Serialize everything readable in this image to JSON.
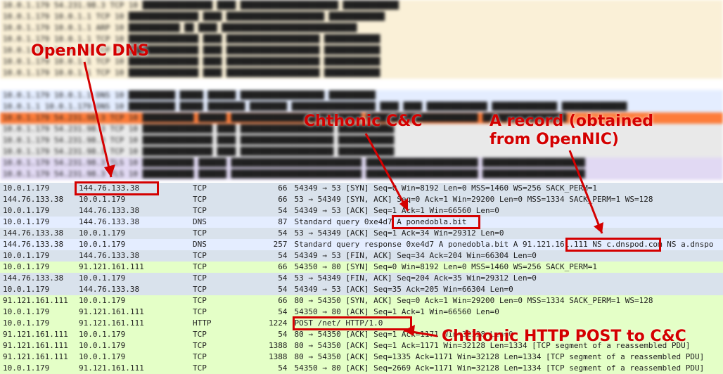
{
  "annotations": {
    "opennic": "OpenNIC DNS",
    "cc": "Chthonic C&C",
    "arecord1": "A record (obtained",
    "arecord2": "from OpenNIC)",
    "httppost": "Chthonic HTTP POST to C&C"
  },
  "packets": [
    {
      "bg": "bg-lightsteel",
      "src": "10.0.1.179",
      "dst": "144.76.133.38",
      "proto": "TCP",
      "len": "66",
      "info": "54349 → 53 [SYN] Seq=0 Win=8192 Len=0 MSS=1460 WS=256 SACK_PERM=1"
    },
    {
      "bg": "bg-lightsteel",
      "src": "144.76.133.38",
      "dst": "10.0.1.179",
      "proto": "TCP",
      "len": "66",
      "info": "53 → 54349 [SYN, ACK] Seq=0 Ack=1 Win=29200 Len=0 MSS=1334 SACK_PERM=1 WS=128"
    },
    {
      "bg": "bg-lightsteel",
      "src": "10.0.1.179",
      "dst": "144.76.133.38",
      "proto": "TCP",
      "len": "54",
      "info": "54349 → 53 [ACK] Seq=1 Ack=1 Win=66560 Len=0"
    },
    {
      "bg": "bg-skyblue",
      "src": "10.0.1.179",
      "dst": "144.76.133.38",
      "proto": "DNS",
      "len": "87",
      "info": "Standard query 0xe4d7 A ponedobla.bit"
    },
    {
      "bg": "bg-lightsteel",
      "src": "144.76.133.38",
      "dst": "10.0.1.179",
      "proto": "TCP",
      "len": "54",
      "info": "53 → 54349 [ACK] Seq=1 Ack=34 Win=29312 Len=0"
    },
    {
      "bg": "bg-skyblue",
      "src": "144.76.133.38",
      "dst": "10.0.1.179",
      "proto": "DNS",
      "len": "257",
      "info": "Standard query response 0xe4d7 A ponedobla.bit A 91.121.161.111 NS c.dnspod.com NS a.dnspo"
    },
    {
      "bg": "bg-lightsteel",
      "src": "10.0.1.179",
      "dst": "144.76.133.38",
      "proto": "TCP",
      "len": "54",
      "info": "54349 → 53 [FIN, ACK] Seq=34 Ack=204 Win=66304 Len=0"
    },
    {
      "bg": "bg-palegreen",
      "src": "10.0.1.179",
      "dst": "91.121.161.111",
      "proto": "TCP",
      "len": "66",
      "info": "54350 → 80 [SYN] Seq=0 Win=8192 Len=0 MSS=1460 WS=256 SACK_PERM=1"
    },
    {
      "bg": "bg-lightsteel",
      "src": "144.76.133.38",
      "dst": "10.0.1.179",
      "proto": "TCP",
      "len": "54",
      "info": "53 → 54349 [FIN, ACK] Seq=204 Ack=35 Win=29312 Len=0"
    },
    {
      "bg": "bg-lightsteel",
      "src": "10.0.1.179",
      "dst": "144.76.133.38",
      "proto": "TCP",
      "len": "54",
      "info": "54349 → 53 [ACK] Seq=35 Ack=205 Win=66304 Len=0"
    },
    {
      "bg": "bg-palegreen",
      "src": "91.121.161.111",
      "dst": "10.0.1.179",
      "proto": "TCP",
      "len": "66",
      "info": "80 → 54350 [SYN, ACK] Seq=0 Ack=1 Win=29200 Len=0 MSS=1334 SACK_PERM=1 WS=128"
    },
    {
      "bg": "bg-palegreen",
      "src": "10.0.1.179",
      "dst": "91.121.161.111",
      "proto": "TCP",
      "len": "54",
      "info": "54350 → 80 [ACK] Seq=1 Ack=1 Win=66560 Len=0"
    },
    {
      "bg": "bg-palegreen",
      "src": "10.0.1.179",
      "dst": "91.121.161.111",
      "proto": "HTTP",
      "len": "1224",
      "info": "POST /net/ HTTP/1.0"
    },
    {
      "bg": "bg-palegreen",
      "src": "91.121.161.111",
      "dst": "10.0.1.179",
      "proto": "TCP",
      "len": "54",
      "info": "80 → 54350 [ACK] Seq=1 Ack=1171 Win=32128 Len=0"
    },
    {
      "bg": "bg-palegreen",
      "src": "91.121.161.111",
      "dst": "10.0.1.179",
      "proto": "TCP",
      "len": "1388",
      "info": "80 → 54350 [ACK] Seq=1 Ack=1171 Win=32128 Len=1334 [TCP segment of a reassembled PDU]"
    },
    {
      "bg": "bg-palegreen",
      "src": "91.121.161.111",
      "dst": "10.0.1.179",
      "proto": "TCP",
      "len": "1388",
      "info": "80 → 54350 [ACK] Seq=1335 Ack=1171 Win=32128 Len=1334 [TCP segment of a reassembled PDU]"
    },
    {
      "bg": "bg-palegreen",
      "src": "10.0.1.179",
      "dst": "91.121.161.111",
      "proto": "TCP",
      "len": "54",
      "info": "54350 → 80 [ACK] Seq=2669 Ack=1171 Win=32128 Len=1334 [TCP segment of a reassembled PDU]"
    }
  ],
  "blur_rows": [
    {
      "bg": "bg-yellow",
      "txt": "10.0.1.179     54.231.98.3      TCP      10 ███████████████ ████ █████████████████████ ████████████"
    },
    {
      "bg": "bg-yellow",
      "txt": "10.0.1.179     10.0.1.1         TCP      10 ███████████████ ████ █████████████████████ ████████████"
    },
    {
      "bg": "bg-yellow",
      "txt": "10.0.1.179     10.0.1.1         ARP      10 ███████████ ██ ████ █████████████████████████████"
    },
    {
      "bg": "bg-yellow",
      "txt": "10.0.1.179     10.0.1.1         TCP      10 ███████████████ ████ ████████████████████ ████████████"
    },
    {
      "bg": "bg-yellow",
      "txt": "10.0.1.179     10.0.1.1         TCP      10 ███████████████ ████ ████████████████████ ████████████"
    },
    {
      "bg": "bg-yellow",
      "txt": "10.0.1.179     10.0.1.1         TCP      10 ███████████████ ████ ████████████████████ ████████████"
    },
    {
      "bg": "bg-yellow",
      "txt": "10.0.1.179     10.0.1.1         TCP      10 ███████████████ ████ ████████████████████ ████████████"
    },
    {
      "bg": "bg-white",
      "txt": ""
    },
    {
      "bg": "bg-skyblue",
      "txt": "10.0.1.179     10.0.1.1         DNS      10 ██████████ █████ ██████ ██████████████████ ██████████"
    },
    {
      "bg": "bg-skyblue",
      "txt": "10.0.1.1       10.0.1.179       DNS      10 ██████████ █████ ████████ ████████ ██████████████████ ████ ████ █████████████ ██████████████ ██████████████"
    },
    {
      "bg": "bg-orange",
      "txt": "10.0.1.179     54.231.98.3      TCP      10 ███████████ ██████ ████████████████████████████ ████████████████████████ ██████████████████"
    },
    {
      "bg": "bg-gray",
      "txt": "10.0.1.179     54.231.98.3      TCP      10 ███████████████ ████ ████████████████████ ████████████"
    },
    {
      "bg": "bg-gray",
      "txt": "10.0.1.179     54.231.98.3      TCP      10 ███████████████ ████ ████████████████████ ████████████"
    },
    {
      "bg": "bg-gray",
      "txt": "10.0.1.179     54.231.98.3      TCP      10 ███████████████ ████ ████████████████████ ████████████"
    },
    {
      "bg": "bg-purple",
      "txt": "10.0.1.179     54.231.98.3      TLS      10 ███████████ ██████ ████████████████████████████ ████████████████████████ ██████████████████████"
    },
    {
      "bg": "bg-purple",
      "txt": "10.0.1.179     54.231.98.3      TLS      10 ███████████ ██████ ████████████████████████████ ████████████████████████ ██████████████████████"
    }
  ]
}
